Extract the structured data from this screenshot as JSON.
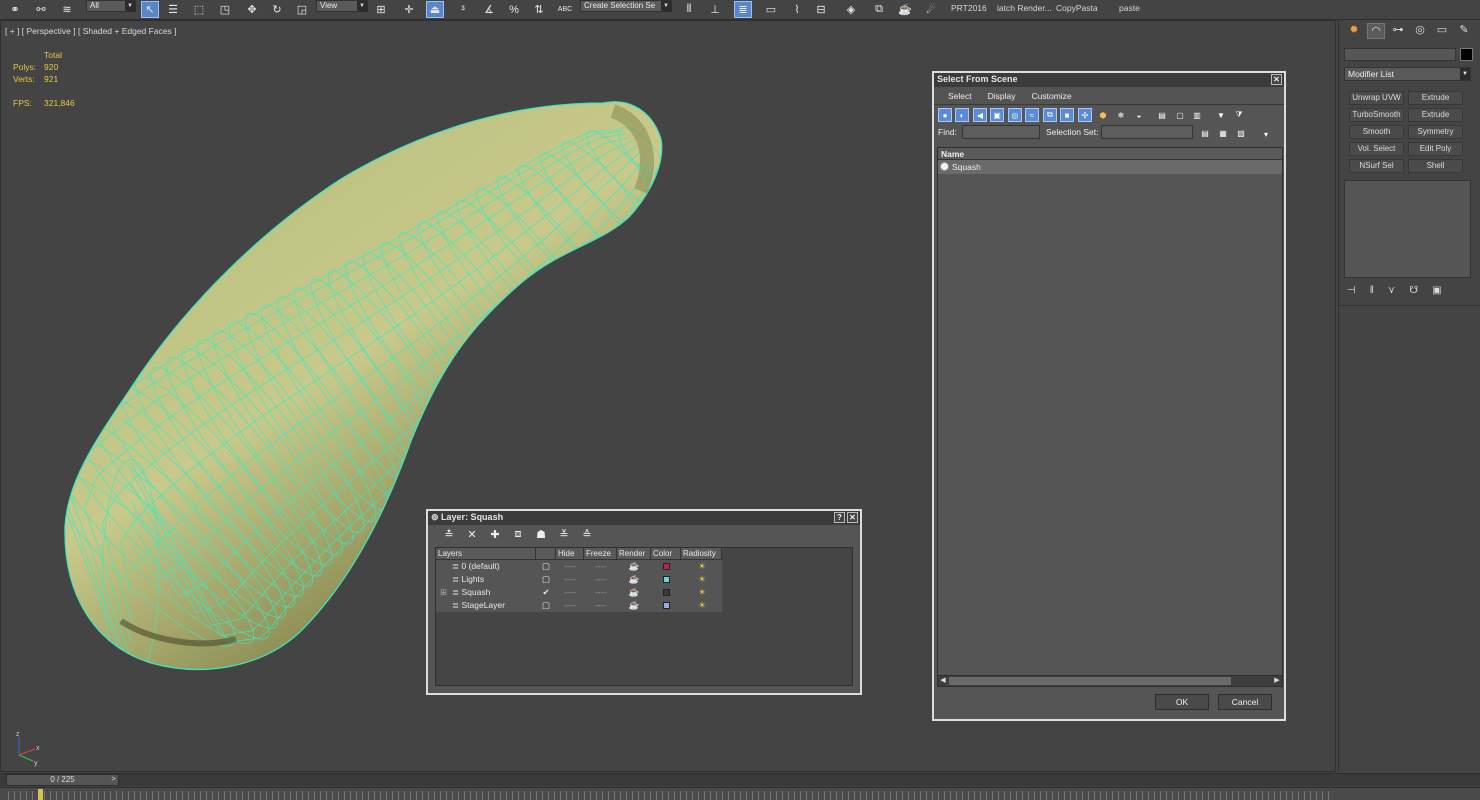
{
  "toolbar": {
    "filter_select": "All",
    "coordinate_select": "View",
    "named_selection_placeholder": "Create Selection Se",
    "spinner_snap_label": "%",
    "abc_label": "ABC",
    "scripts": [
      "PRT2016",
      "iatch Render...",
      "CopyPasta",
      "paste"
    ]
  },
  "viewport": {
    "label": "[ + ] [ Perspective ] [ Shaded + Edged Faces ]",
    "stats": {
      "header": "Total",
      "polys_label": "Polys:",
      "polys_value": "920",
      "verts_label": "Verts:",
      "verts_value": "921",
      "fps_label": "FPS:",
      "fps_value": "321,846"
    },
    "axis_labels": {
      "x": "x",
      "y": "y",
      "z": "z"
    },
    "colors": {
      "wire": "#3de8c0",
      "stats": "#e7c84a"
    }
  },
  "layer_dialog": {
    "title": "Layer: Squash",
    "help_btn": "?",
    "close_btn": "✕",
    "columns": [
      "Layers",
      "",
      "Hide",
      "Freeze",
      "Render",
      "Color",
      "Radiosity"
    ],
    "rows": [
      {
        "name": "0 (default)",
        "current": false,
        "expand": "",
        "color": "#c0234e"
      },
      {
        "name": "Lights",
        "current": false,
        "expand": "",
        "color": "#6ad6d6"
      },
      {
        "name": "Squash",
        "current": true,
        "expand": "⊞",
        "color": "#3a3a3a"
      },
      {
        "name": "StageLayer",
        "current": false,
        "expand": "",
        "color": "#8fb0e8"
      }
    ],
    "hide_mark": "----",
    "freeze_mark": "----",
    "current_mark": "✔"
  },
  "scene_dialog": {
    "title": "Select From Scene",
    "close_btn": "✕",
    "menu": [
      "Select",
      "Display",
      "Customize"
    ],
    "find_label": "Find:",
    "selection_set_label": "Selection Set:",
    "list_header": "Name",
    "items": [
      "Squash"
    ],
    "ok_label": "OK",
    "cancel_label": "Cancel",
    "scroll_left": "◀",
    "scroll_right": "▶"
  },
  "command_panel": {
    "modifier_list_label": "Modifier List",
    "object_color": "#000000",
    "modifier_buttons": [
      "Unwrap UVW",
      "Extrude",
      "TurboSmooth",
      "Extrude",
      "Smooth",
      "Symmetry",
      "Vol. Select",
      "Edit Poly",
      "NSurf Sel",
      "Shell"
    ]
  },
  "timeline": {
    "frame_display": "0 / 225",
    "next_arrow": ">"
  }
}
